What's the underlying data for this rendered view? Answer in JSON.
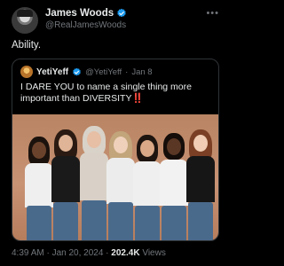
{
  "tweet": {
    "author_name": "James Woods",
    "author_handle": "@RealJamesWoods",
    "more_icon": "more-horizontal-icon",
    "text": "Ability.",
    "timestamp": "4:39 AM · Jan 20, 2024 · ",
    "views_count": "202.4K",
    "views_label": " Views"
  },
  "quote": {
    "author_name": "YetiYeff",
    "author_handle": "@YetiYeff",
    "separator": "·",
    "date": "Jan 8",
    "text": "I DARE YOU to name a single thing more important than DIVERSITY",
    "emoji": "‼️",
    "photo": "group-of-seven-women-photo"
  },
  "colors": {
    "background": "#000000",
    "text_primary": "#e7e9ea",
    "text_secondary": "#71767b",
    "border": "#2f3336",
    "verified": "#1d9bf0"
  }
}
